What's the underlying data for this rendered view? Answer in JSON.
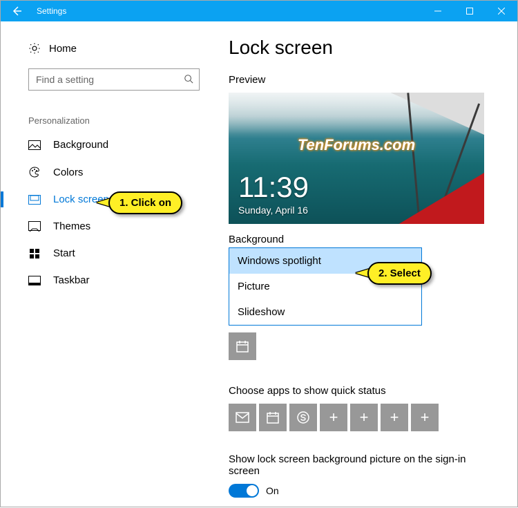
{
  "titlebar": {
    "title": "Settings"
  },
  "sidebar": {
    "home_label": "Home",
    "search_placeholder": "Find a setting",
    "category": "Personalization",
    "items": [
      {
        "label": "Background"
      },
      {
        "label": "Colors"
      },
      {
        "label": "Lock screen"
      },
      {
        "label": "Themes"
      },
      {
        "label": "Start"
      },
      {
        "label": "Taskbar"
      }
    ]
  },
  "main": {
    "heading": "Lock screen",
    "preview_label": "Preview",
    "preview": {
      "watermark": "TenForums.com",
      "time": "11:39",
      "date": "Sunday, April 16"
    },
    "background_label": "Background",
    "dropdown": {
      "options": [
        "Windows spotlight",
        "Picture",
        "Slideshow"
      ],
      "selected_index": 0
    },
    "choose_apps_label": "Choose apps to show quick status",
    "signin_label": "Show lock screen background picture on the sign-in screen",
    "toggle_state": "On"
  },
  "callouts": {
    "c1": "1. Click on",
    "c2": "2. Select"
  }
}
